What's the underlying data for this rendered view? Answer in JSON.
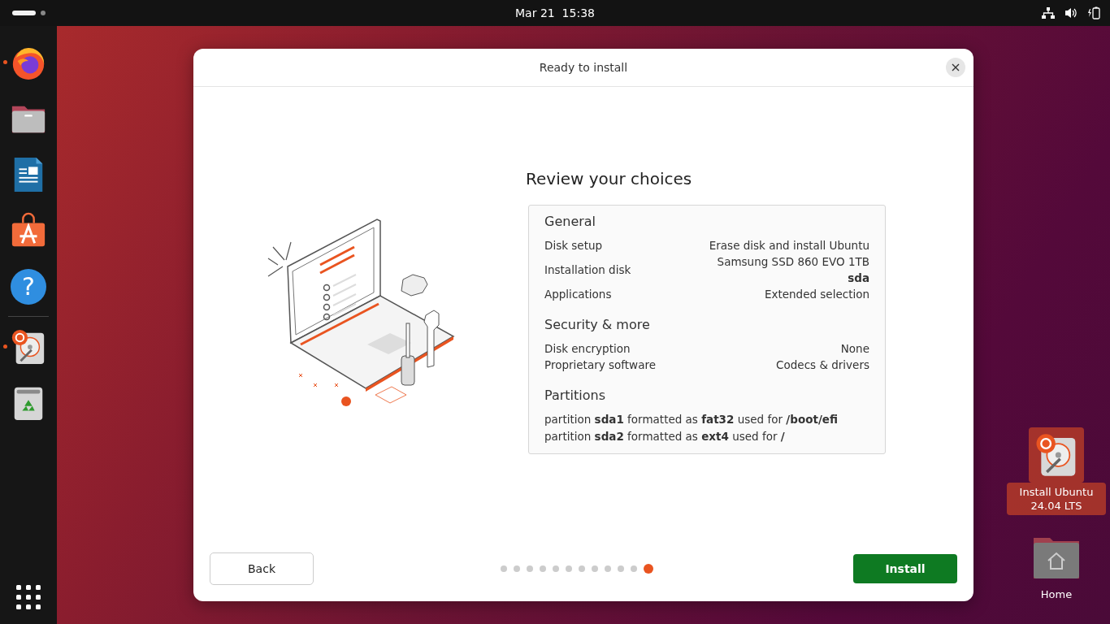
{
  "top_bar": {
    "workspaces": [
      {
        "selected": true
      },
      {
        "selected": false
      }
    ],
    "clock": "Mar 21  15:38"
  },
  "dock": {
    "items": [
      {
        "kind": "firefox",
        "running": true
      },
      {
        "kind": "files",
        "running": false
      },
      {
        "kind": "writer",
        "running": false
      },
      {
        "kind": "app-center",
        "running": false
      },
      {
        "kind": "help",
        "running": false,
        "glyph": "?"
      },
      {
        "kind": "separator"
      },
      {
        "kind": "installer",
        "running": true
      },
      {
        "kind": "trash",
        "running": false
      }
    ]
  },
  "window": {
    "title": "Ready to install",
    "heading": "Review your choices",
    "sections": [
      {
        "title": "General",
        "rows": [
          {
            "label": "Disk setup",
            "value": "Erase disk and install Ubuntu"
          },
          {
            "label": "Installation disk",
            "value": "Samsung SSD 860 EVO 1TB",
            "value_detail": "sda"
          },
          {
            "label": "Applications",
            "value": "Extended selection"
          }
        ]
      },
      {
        "title": "Security & more",
        "rows": [
          {
            "label": "Disk encryption",
            "value": "None"
          },
          {
            "label": "Proprietary software",
            "value": "Codecs & drivers"
          }
        ]
      }
    ],
    "partitions": {
      "title": "Partitions",
      "lines": [
        "partition **sda1** formatted as **fat32** used for **/boot/efi**",
        "partition **sda2** formatted as **ext4** used for **/**"
      ]
    },
    "back_button": "Back",
    "install_button": "Install",
    "steps": [
      {
        "selected": false
      },
      {
        "selected": false
      },
      {
        "selected": false
      },
      {
        "selected": false
      },
      {
        "selected": false
      },
      {
        "selected": false
      },
      {
        "selected": false
      },
      {
        "selected": false
      },
      {
        "selected": false
      },
      {
        "selected": false
      },
      {
        "selected": false
      },
      {
        "selected": true
      }
    ]
  },
  "desktop_icons": [
    {
      "kind": "installer",
      "label": "Install Ubuntu 24.04 LTS",
      "selected": true
    },
    {
      "kind": "home",
      "label": "Home",
      "selected": false
    }
  ]
}
